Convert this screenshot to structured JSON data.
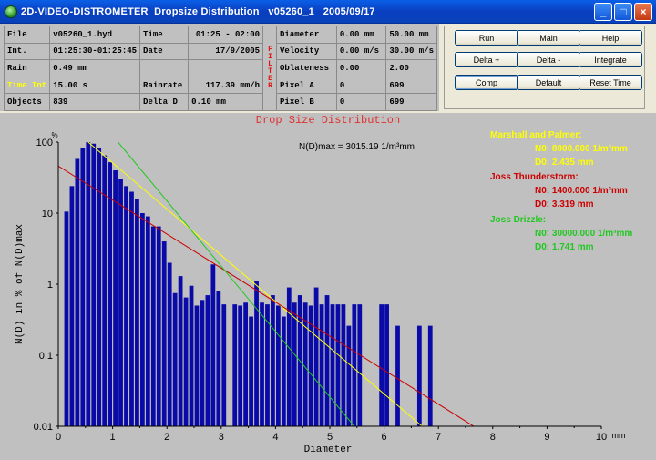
{
  "window": {
    "title": "2D-VIDEO-DISTROMETER  Dropsize Distribution   v05260_1   2005/09/17",
    "buttons": {
      "minimize": "_",
      "maximize": "□",
      "close": "×"
    }
  },
  "info": {
    "rows": [
      [
        "File",
        "v05260_1.hyd",
        "Time",
        "01:25 - 02:00",
        "Diameter",
        "0.00 mm",
        "50.00 mm"
      ],
      [
        "Int.",
        "01:25:30-01:25:45",
        "Date",
        "17/9/2005",
        "Velocity",
        "0.00 m/s",
        "30.00 m/s"
      ],
      [
        "Rain",
        "0.49 mm",
        "",
        "",
        "Oblateness",
        "0.00",
        "2.00"
      ],
      [
        "Time Int",
        "15.00 s",
        "Rainrate",
        "117.39 mm/h",
        "Pixel A",
        "0",
        "699"
      ],
      [
        "Objects",
        "839",
        "Delta D",
        "0.10 mm",
        "Pixel B",
        "0",
        "699"
      ]
    ],
    "filter_label": "FILTER"
  },
  "buttons": {
    "run": "Run",
    "main": "Main",
    "help": "Help",
    "delta_plus": "Delta +",
    "delta_minus": "Delta -",
    "integrate": "Integrate",
    "comp": "Comp",
    "default": "Default",
    "reset_time": "Reset Time"
  },
  "chart_data": {
    "type": "bar",
    "title": "Drop Size Distribution",
    "xlabel": "Diameter",
    "ylabel": "N(D) in % of N(D)max",
    "x_unit": "mm",
    "y_unit": "%",
    "y_scale": "log",
    "xlim": [
      0,
      10
    ],
    "ylim": [
      0.01,
      100
    ],
    "xticks": [
      "0",
      "1",
      "2",
      "3",
      "4",
      "5",
      "6",
      "7",
      "8",
      "9",
      "10"
    ],
    "yticks": [
      "0.01",
      "0.1",
      "1",
      "10",
      "100"
    ],
    "annotation": "N(D)max = 3015.19 1/m³mm",
    "bar_width_mm": 0.08,
    "bars": [
      [
        0.15,
        10.5
      ],
      [
        0.25,
        24
      ],
      [
        0.35,
        58
      ],
      [
        0.45,
        82
      ],
      [
        0.55,
        100
      ],
      [
        0.65,
        95
      ],
      [
        0.75,
        82
      ],
      [
        0.85,
        65
      ],
      [
        0.95,
        52
      ],
      [
        1.05,
        40
      ],
      [
        1.15,
        30
      ],
      [
        1.25,
        24
      ],
      [
        1.35,
        20
      ],
      [
        1.45,
        16
      ],
      [
        1.55,
        10
      ],
      [
        1.65,
        9
      ],
      [
        1.75,
        6.5
      ],
      [
        1.85,
        6.5
      ],
      [
        1.95,
        4
      ],
      [
        2.05,
        2
      ],
      [
        2.15,
        0.75
      ],
      [
        2.25,
        1.3
      ],
      [
        2.35,
        0.65
      ],
      [
        2.45,
        0.95
      ],
      [
        2.55,
        0.5
      ],
      [
        2.65,
        0.6
      ],
      [
        2.75,
        0.7
      ],
      [
        2.85,
        1.9
      ],
      [
        2.95,
        0.8
      ],
      [
        3.05,
        0.52
      ],
      [
        3.25,
        0.52
      ],
      [
        3.35,
        0.5
      ],
      [
        3.45,
        0.55
      ],
      [
        3.55,
        0.35
      ],
      [
        3.65,
        1.1
      ],
      [
        3.75,
        0.55
      ],
      [
        3.85,
        0.52
      ],
      [
        3.95,
        0.7
      ],
      [
        4.05,
        0.5
      ],
      [
        4.15,
        0.35
      ],
      [
        4.25,
        0.9
      ],
      [
        4.35,
        0.55
      ],
      [
        4.45,
        0.7
      ],
      [
        4.55,
        0.55
      ],
      [
        4.65,
        0.5
      ],
      [
        4.75,
        0.9
      ],
      [
        4.85,
        0.52
      ],
      [
        4.95,
        0.7
      ],
      [
        5.05,
        0.52
      ],
      [
        5.15,
        0.52
      ],
      [
        5.25,
        0.52
      ],
      [
        5.35,
        0.26
      ],
      [
        5.45,
        0.52
      ],
      [
        5.55,
        0.52
      ],
      [
        5.95,
        0.52
      ],
      [
        6.05,
        0.52
      ],
      [
        6.25,
        0.26
      ],
      [
        6.65,
        0.26
      ],
      [
        6.85,
        0.26
      ]
    ],
    "series": [
      {
        "name": "Marshall and Palmer",
        "color": "#ffff00",
        "N0": "8000.000 1/m³mm",
        "D0": "2.435 mm",
        "line": [
          [
            0.55,
            100
          ],
          [
            6.7,
            0.01
          ]
        ]
      },
      {
        "name": "Joss Thunderstorm",
        "color": "#cc0000",
        "N0": "1400.000 1/m³mm",
        "D0": "3.319 mm",
        "line": [
          [
            0,
            46
          ],
          [
            7.65,
            0.01
          ]
        ]
      },
      {
        "name": "Joss Drizzle",
        "color": "#1fc81f",
        "N0": "30000.000 1/m³mm",
        "D0": "1.741 mm",
        "line": [
          [
            1.1,
            100
          ],
          [
            5.45,
            0.01
          ]
        ]
      }
    ],
    "legend": [
      {
        "name": "Marshall and Palmer:",
        "color": "#ffff00",
        "n0": "N0: 8000.000 1/m³mm",
        "d0": "D0: 2.435 mm"
      },
      {
        "name": "Joss Thunderstorm:",
        "color": "#cc0000",
        "n0": "N0: 1400.000 1/m³mm",
        "d0": "D0: 3.319 mm"
      },
      {
        "name": "Joss Drizzle:",
        "color": "#1fc81f",
        "n0": "N0: 30000.000 1/m³mm",
        "d0": "D0: 1.741 mm"
      }
    ],
    "bar_color": "#0a0aa8",
    "grid": false
  }
}
